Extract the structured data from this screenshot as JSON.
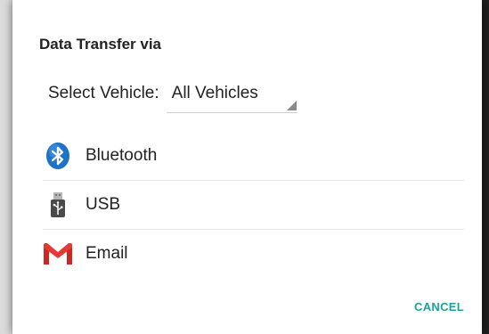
{
  "dialog": {
    "title": "Data Transfer via",
    "select_vehicle": {
      "label": "Select Vehicle:",
      "value": "All Vehicles"
    },
    "options": [
      {
        "label": "Bluetooth",
        "icon": "bluetooth-icon"
      },
      {
        "label": "USB",
        "icon": "usb-icon"
      },
      {
        "label": "Email",
        "icon": "gmail-icon"
      }
    ],
    "cancel_label": "CANCEL"
  },
  "colors": {
    "accent": "#1aa39a",
    "bluetooth": "#1e73c8",
    "gmail_red": "#d93025"
  }
}
